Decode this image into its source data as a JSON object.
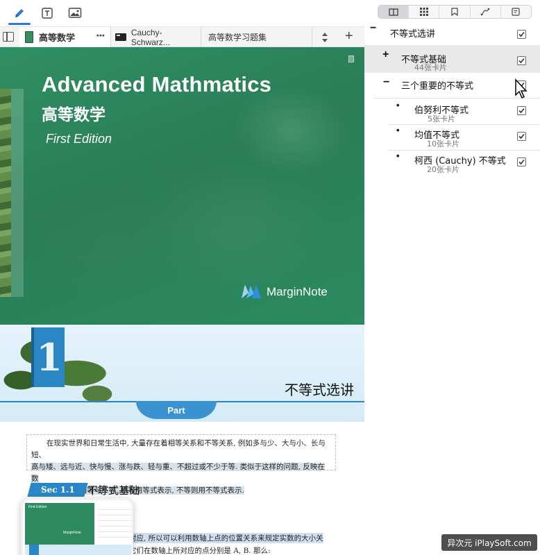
{
  "toolbar": {
    "tools": [
      {
        "name": "pen-icon",
        "active": true
      },
      {
        "name": "text-icon",
        "active": false
      },
      {
        "name": "image-icon",
        "active": false
      }
    ],
    "view_modes": [
      {
        "name": "book-view-icon",
        "active": true
      },
      {
        "name": "grid-view-icon",
        "active": false
      },
      {
        "name": "bookmark-icon",
        "active": false
      },
      {
        "name": "mindmap-icon",
        "active": false
      },
      {
        "name": "card-icon",
        "active": false
      }
    ],
    "accent_color": "#2b7bd6"
  },
  "tabs": [
    {
      "label": "高等数学",
      "icon": "book-icon",
      "active": true
    },
    {
      "label": "Cauchy-Schwarz...",
      "icon": "terminal-icon",
      "active": false
    },
    {
      "label": "高等数学习题集",
      "icon": null,
      "active": false
    }
  ],
  "tabbar": {
    "more": "⋮",
    "add": "+"
  },
  "book": {
    "cover_title": "Advanced Mathmatics",
    "cover_subtitle": "高等数学",
    "edition": "First Edition",
    "brand": "MarginNote",
    "cover_color": "#2f8f63",
    "chapter_number": "1",
    "chapter_title": "不等式选讲",
    "part_label": "Part",
    "intro_lines": [
      "在现实世界和日常生活中, 大量存在着相等关系和不等关系, 例如多与少、大与小、长与短、",
      "高与矮、远与近、快与慢、涨与跌、轻与重、不超过或不少于等. 类似于这样的问题, 反映在数",
      "量关系上, 就是相等与不等. 相等用等式表示, 不等则用不等式表示."
    ],
    "section_badge": "Sec 1.1",
    "section_title": "不等式基础",
    "body_line_1": "对应, 所以可以利用数轴上点的位置关系来规定实数的大小关",
    "body_line_2": "它们在数轴上所对应的点分别是 A, B. 那么:",
    "thumb_cover_text": "First Edition",
    "thumb_brand": "MarginNote"
  },
  "outline": {
    "items": [
      {
        "marker": "−",
        "title": "不等式选讲",
        "count": "",
        "checked": true,
        "level": 0,
        "selected": false
      },
      {
        "marker": "+",
        "title": "不等式基础",
        "count": "44张卡片",
        "checked": true,
        "level": 1,
        "selected": true
      },
      {
        "marker": "−",
        "title": "三个重要的不等式",
        "count": "",
        "checked": true,
        "level": 1,
        "selected": false
      },
      {
        "marker": "•",
        "title": "伯努利不等式",
        "count": "5张卡片",
        "checked": true,
        "level": 2,
        "selected": false
      },
      {
        "marker": "•",
        "title": "均值不等式",
        "count": "10张卡片",
        "checked": true,
        "level": 2,
        "selected": false
      },
      {
        "marker": "•",
        "title": "柯西 (Cauchy) 不等式",
        "count": "20张卡片",
        "checked": true,
        "level": 2,
        "selected": false
      }
    ]
  },
  "watermark": "异次元 iPlaySoft.com"
}
